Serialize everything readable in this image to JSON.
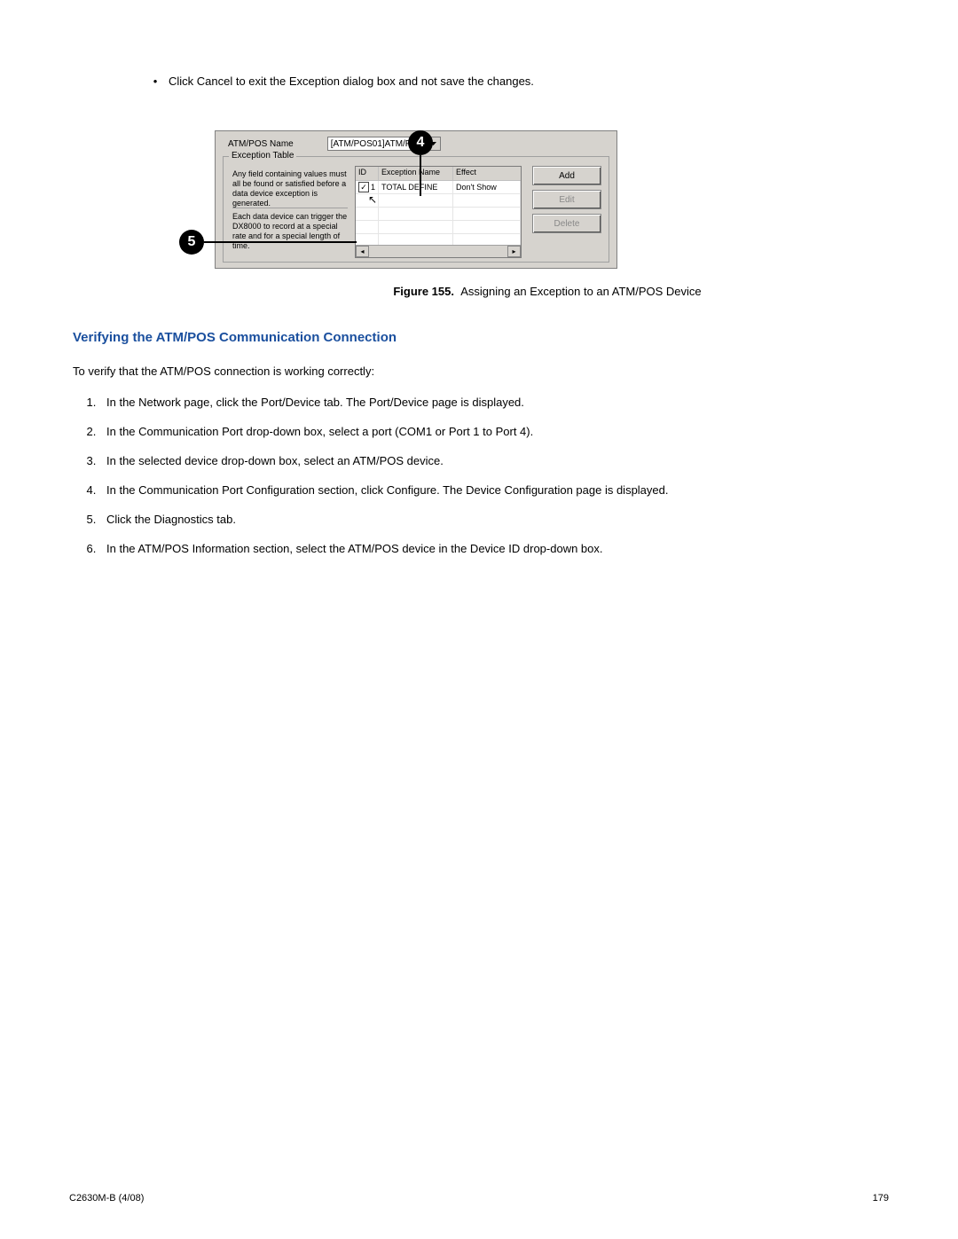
{
  "bullet_text": "Click Cancel to exit the Exception dialog box and not save the changes.",
  "callouts": {
    "c4": "4",
    "c5": "5"
  },
  "dialog": {
    "name_label": "ATM/POS Name",
    "dropdown_value": "[ATM/POS01]ATM/POS01",
    "groupbox_label": "Exception Table",
    "help_text_1": "Any field containing values must all be found or satisfied before a data device exception is generated.",
    "help_text_2": "Each data device can trigger the DX8000 to record at a special rate and for a special length of time.",
    "table": {
      "headers": {
        "id": "ID",
        "name": "Exception Name",
        "effect": "Effect"
      },
      "row1": {
        "id": "1",
        "name": "TOTAL DEFINE",
        "effect": "Don't Show"
      }
    },
    "buttons": {
      "add": "Add",
      "edit": "Edit",
      "delete": "Delete"
    }
  },
  "figure_caption_label": "Figure 155.",
  "figure_caption_text": "Assigning an Exception to an ATM/POS Device",
  "section_heading": "Verifying the ATM/POS Communication Connection",
  "intro_text": "To verify that the ATM/POS connection is working correctly:",
  "steps": [
    "In the Network page, click the Port/Device tab. The Port/Device page is displayed.",
    "In the Communication Port drop-down box, select a port (COM1 or Port 1 to Port 4).",
    "In the selected device drop-down box, select an ATM/POS device.",
    "In the Communication Port Configuration section, click Configure. The Device Configuration page is displayed.",
    "Click the Diagnostics tab.",
    "In the ATM/POS Information section, select the ATM/POS device in the Device ID drop-down box."
  ],
  "footer": {
    "left": "C2630M-B (4/08)",
    "right": "179"
  }
}
